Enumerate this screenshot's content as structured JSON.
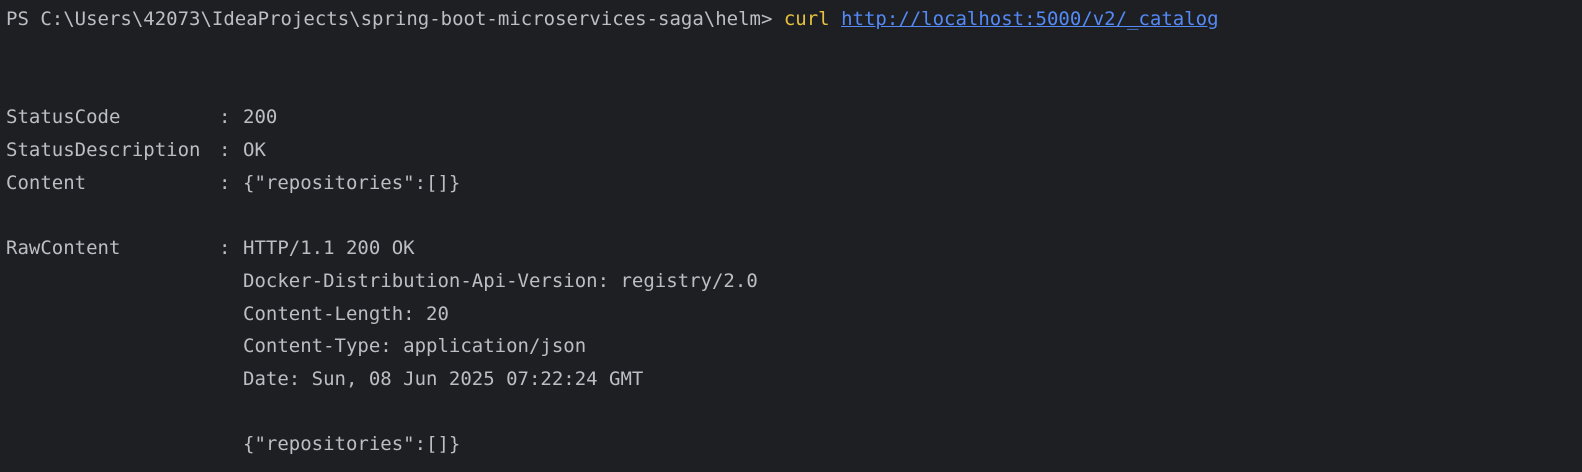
{
  "terminal": {
    "prompt": "PS C:\\Users\\42073\\IdeaProjects\\spring-boot-microservices-saga\\helm> ",
    "command": "curl",
    "url": "http://localhost:5000/v2/_catalog"
  },
  "response": {
    "separator": ":",
    "status_code": {
      "key": "StatusCode",
      "value": "200"
    },
    "status_description": {
      "key": "StatusDescription",
      "value": "OK"
    },
    "content": {
      "key": "Content",
      "value": "{\"repositories\":[]}"
    },
    "raw_content": {
      "key": "RawContent",
      "lines": [
        "HTTP/1.1 200 OK",
        "Docker-Distribution-Api-Version: registry/2.0",
        "Content-Length: 20",
        "Content-Type: application/json",
        "Date: Sun, 08 Jun 2025 07:22:24 GMT",
        "{\"repositories\":[]}"
      ]
    }
  },
  "colors": {
    "background": "#1e1f22",
    "text": "#bcbec4",
    "command": "#e5c141",
    "link": "#548af7"
  }
}
